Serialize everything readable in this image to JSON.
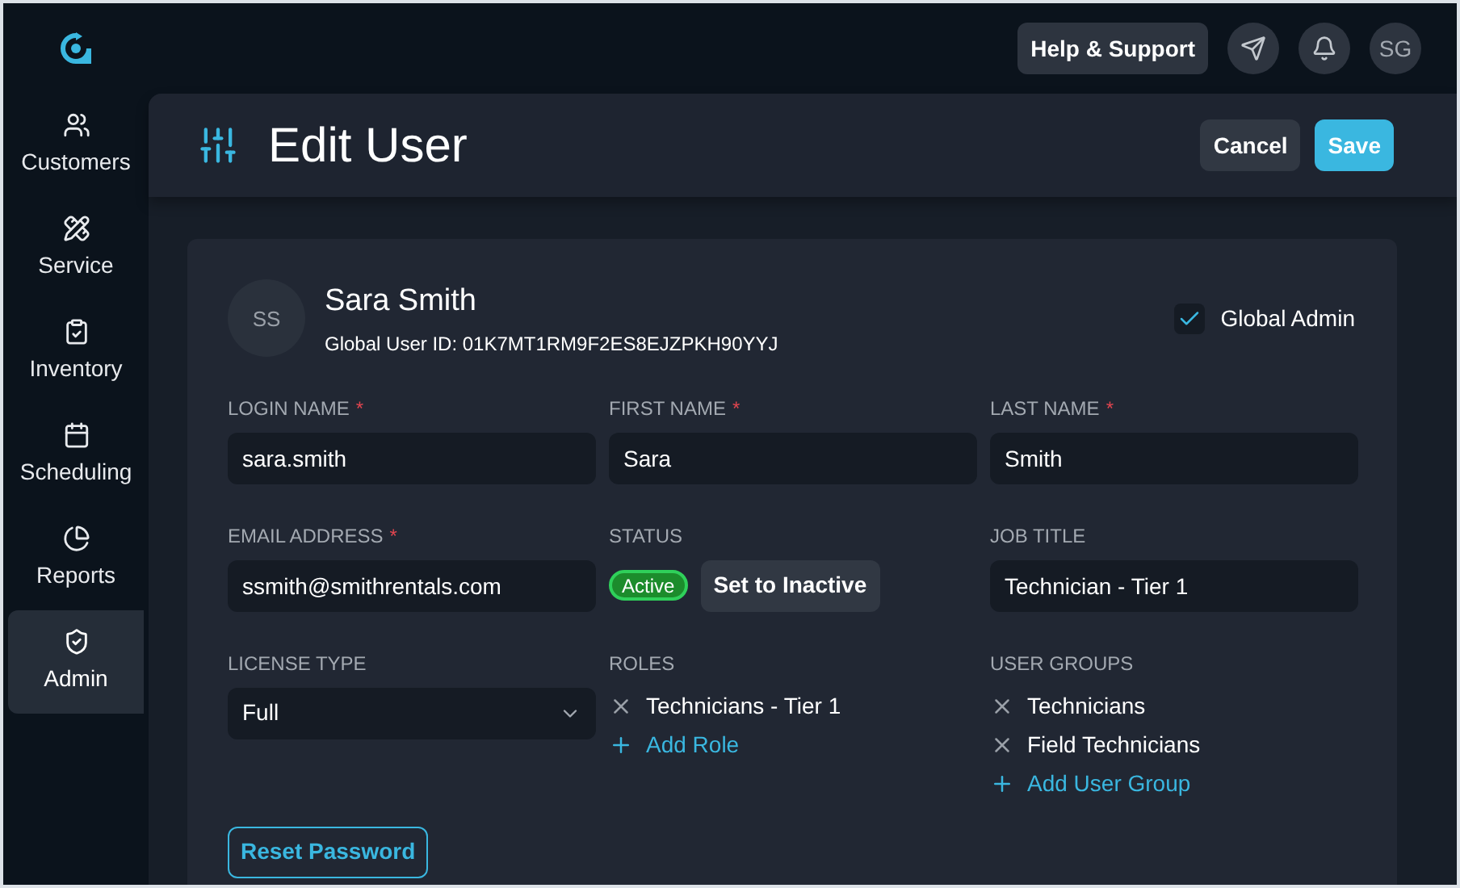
{
  "top_bar": {
    "help_button": "Help & Support",
    "avatar": "SG"
  },
  "sidebar": {
    "items": [
      {
        "label": "Customers",
        "selected": false
      },
      {
        "label": "Service",
        "selected": false
      },
      {
        "label": "Inventory",
        "selected": false
      },
      {
        "label": "Scheduling",
        "selected": false
      },
      {
        "label": "Reports",
        "selected": false
      },
      {
        "label": "Admin",
        "selected": true
      }
    ]
  },
  "header": {
    "title": "Edit User",
    "cancel_button": "Cancel",
    "save_button": "Save"
  },
  "user": {
    "initials": "SS",
    "name": "Sara Smith",
    "global_id": "Global User ID: 01K7MT1RM9F2ES8EJZPKH90YYJ",
    "global_admin": {
      "label": "Global Admin",
      "checked": true
    }
  },
  "fields": [
    {
      "kind": "text",
      "label": "LOGIN NAME",
      "required_mark": "*",
      "value": "sara.smith"
    },
    {
      "kind": "text",
      "label": "FIRST NAME",
      "required_mark": "*",
      "value": "Sara"
    },
    {
      "kind": "text",
      "label": "LAST NAME",
      "required_mark": "*",
      "value": "Smith"
    },
    {
      "kind": "text",
      "label": "EMAIL ADDRESS",
      "required_mark": "*",
      "value": "ssmith@smithrentals.com"
    },
    {
      "kind": "status",
      "label": "STATUS",
      "badge": "Active",
      "active": true,
      "button": "Set to Inactive"
    },
    {
      "kind": "text",
      "label": "JOB TITLE",
      "value": "Technician - Tier 1"
    },
    {
      "kind": "select",
      "label": "LICENSE TYPE",
      "value": "Full"
    },
    {
      "kind": "list",
      "label": "ROLES",
      "items": [
        "Technicians - Tier 1"
      ],
      "add": "Add Role"
    },
    {
      "kind": "list",
      "label": "USER GROUPS",
      "items": [
        "Technicians",
        "Field Technicians"
      ],
      "add": "Add User Group"
    }
  ],
  "reset_button": "Reset Password"
}
